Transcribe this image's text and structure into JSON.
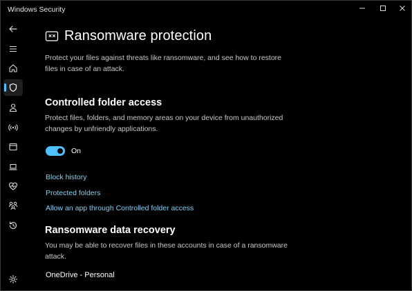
{
  "window": {
    "title": "Windows Security"
  },
  "sidebar": {
    "items": [
      {
        "icon": "back-arrow-icon"
      },
      {
        "icon": "hamburger-menu-icon"
      },
      {
        "icon": "home-icon"
      },
      {
        "icon": "shield-icon",
        "active": true
      },
      {
        "icon": "person-icon"
      },
      {
        "icon": "wireless-icon"
      },
      {
        "icon": "app-browser-icon"
      },
      {
        "icon": "laptop-icon"
      },
      {
        "icon": "heart-pulse-icon"
      },
      {
        "icon": "family-icon"
      },
      {
        "icon": "history-icon"
      },
      {
        "icon": "gear-icon"
      }
    ]
  },
  "page": {
    "title": "Ransomware protection",
    "description": "Protect your files against threats like ransomware, and see how to restore files in case of an attack."
  },
  "controlled_folder_access": {
    "title": "Controlled folder access",
    "description": "Protect files, folders, and memory areas on your device from unauthorized changes by unfriendly applications.",
    "toggle_state": true,
    "toggle_label": "On",
    "links": {
      "block_history": "Block history",
      "protected_folders": "Protected folders",
      "allow_app": "Allow an app through Controlled folder access"
    }
  },
  "data_recovery": {
    "title": "Ransomware data recovery",
    "description": "You may be able to recover files in these accounts in case of a ransomware attack.",
    "account": "OneDrive - Personal"
  },
  "colors": {
    "accent": "#4cc2ff",
    "link": "#7dd3f5",
    "background": "#000000"
  }
}
